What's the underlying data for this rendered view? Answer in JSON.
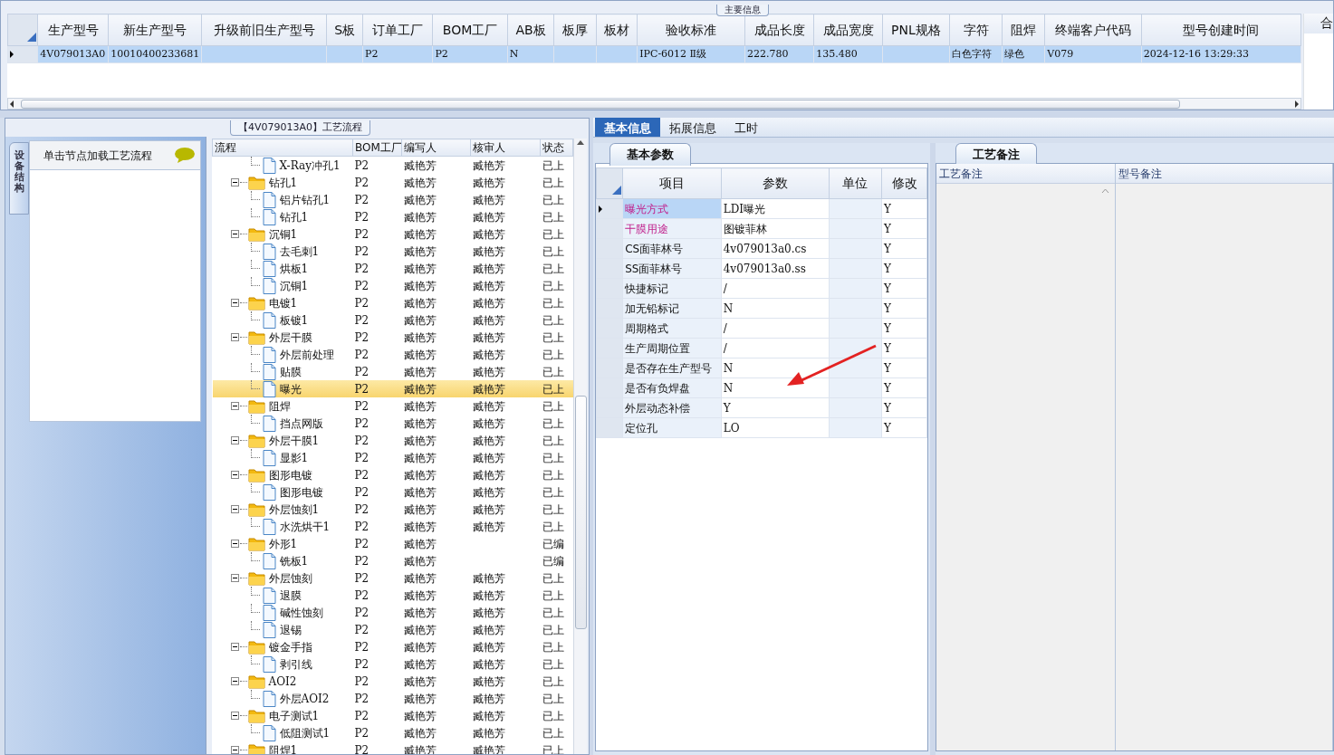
{
  "main_info": {
    "caption": "主要信息",
    "columns": [
      "生产型号",
      "新生产型号",
      "升级前旧生产型号",
      "S板",
      "订单工厂",
      "BOM工厂",
      "AB板",
      "板厚",
      "板材",
      "验收标准",
      "成品长度",
      "成品宽度",
      "PNL规格",
      "字符",
      "阻焊",
      "终端客户代码",
      "型号创建时间"
    ],
    "rows": [
      {
        "selected": true,
        "cells": [
          "4V079013A0",
          "10010400233681",
          null,
          null,
          "P2",
          "P2",
          "N",
          null,
          null,
          "IPC-6012 Ⅱ级",
          "222.780",
          "135.480",
          null,
          "白色字符",
          "绿色",
          "V079",
          "2024-12-16 13:29:33"
        ]
      }
    ],
    "side_column": "合"
  },
  "process": {
    "caption": "【4V079013A0】工艺流程",
    "side_tab": "设备结构",
    "hint": "单击节点加载工艺流程",
    "columns": [
      "流程",
      "BOM工厂",
      "编写人",
      "核审人",
      "状态"
    ],
    "tree": [
      {
        "kind": "file",
        "name": "X-Ray冲孔1",
        "bom": "P2",
        "author": "臧艳芳",
        "reviewer": "臧艳芳",
        "status": "已上",
        "selected": false
      },
      {
        "kind": "folder",
        "name": "钻孔1",
        "bom": "P2",
        "author": "臧艳芳",
        "reviewer": "臧艳芳",
        "status": "已上",
        "selected": false,
        "expanded": true,
        "children": [
          {
            "kind": "file",
            "name": "铝片钻孔1",
            "bom": "P2",
            "author": "臧艳芳",
            "reviewer": "臧艳芳",
            "status": "已上",
            "selected": false
          },
          {
            "kind": "file",
            "name": "钻孔1",
            "bom": "P2",
            "author": "臧艳芳",
            "reviewer": "臧艳芳",
            "status": "已上",
            "selected": false
          }
        ]
      },
      {
        "kind": "folder",
        "name": "沉铜1",
        "bom": "P2",
        "author": "臧艳芳",
        "reviewer": "臧艳芳",
        "status": "已上",
        "selected": false,
        "expanded": true,
        "children": [
          {
            "kind": "file",
            "name": "去毛刺1",
            "bom": "P2",
            "author": "臧艳芳",
            "reviewer": "臧艳芳",
            "status": "已上",
            "selected": false
          },
          {
            "kind": "file",
            "name": "烘板1",
            "bom": "P2",
            "author": "臧艳芳",
            "reviewer": "臧艳芳",
            "status": "已上",
            "selected": false
          },
          {
            "kind": "file",
            "name": "沉铜1",
            "bom": "P2",
            "author": "臧艳芳",
            "reviewer": "臧艳芳",
            "status": "已上",
            "selected": false
          }
        ]
      },
      {
        "kind": "folder",
        "name": "电镀1",
        "bom": "P2",
        "author": "臧艳芳",
        "reviewer": "臧艳芳",
        "status": "已上",
        "selected": false,
        "expanded": true,
        "children": [
          {
            "kind": "file",
            "name": "板镀1",
            "bom": "P2",
            "author": "臧艳芳",
            "reviewer": "臧艳芳",
            "status": "已上",
            "selected": false
          }
        ]
      },
      {
        "kind": "folder",
        "name": "外层干膜",
        "bom": "P2",
        "author": "臧艳芳",
        "reviewer": "臧艳芳",
        "status": "已上",
        "selected": false,
        "expanded": true,
        "children": [
          {
            "kind": "file",
            "name": "外层前处理",
            "bom": "P2",
            "author": "臧艳芳",
            "reviewer": "臧艳芳",
            "status": "已上",
            "selected": false
          },
          {
            "kind": "file",
            "name": "贴膜",
            "bom": "P2",
            "author": "臧艳芳",
            "reviewer": "臧艳芳",
            "status": "已上",
            "selected": false
          },
          {
            "kind": "file",
            "name": "曝光",
            "bom": "P2",
            "author": "臧艳芳",
            "reviewer": "臧艳芳",
            "status": "已上",
            "selected": true
          }
        ]
      },
      {
        "kind": "folder",
        "name": "阻焊",
        "bom": "P2",
        "author": "臧艳芳",
        "reviewer": "臧艳芳",
        "status": "已上",
        "selected": false,
        "expanded": true,
        "children": [
          {
            "kind": "file",
            "name": "挡点网版",
            "bom": "P2",
            "author": "臧艳芳",
            "reviewer": "臧艳芳",
            "status": "已上",
            "selected": false
          }
        ]
      },
      {
        "kind": "folder",
        "name": "外层干膜1",
        "bom": "P2",
        "author": "臧艳芳",
        "reviewer": "臧艳芳",
        "status": "已上",
        "selected": false,
        "expanded": true,
        "children": [
          {
            "kind": "file",
            "name": "显影1",
            "bom": "P2",
            "author": "臧艳芳",
            "reviewer": "臧艳芳",
            "status": "已上",
            "selected": false
          }
        ]
      },
      {
        "kind": "folder",
        "name": "图形电镀",
        "bom": "P2",
        "author": "臧艳芳",
        "reviewer": "臧艳芳",
        "status": "已上",
        "selected": false,
        "expanded": true,
        "children": [
          {
            "kind": "file",
            "name": "图形电镀",
            "bom": "P2",
            "author": "臧艳芳",
            "reviewer": "臧艳芳",
            "status": "已上",
            "selected": false
          }
        ]
      },
      {
        "kind": "folder",
        "name": "外层蚀刻1",
        "bom": "P2",
        "author": "臧艳芳",
        "reviewer": "臧艳芳",
        "status": "已上",
        "selected": false,
        "expanded": true,
        "children": [
          {
            "kind": "file",
            "name": "水洗烘干1",
            "bom": "P2",
            "author": "臧艳芳",
            "reviewer": "臧艳芳",
            "status": "已上",
            "selected": false
          }
        ]
      },
      {
        "kind": "folder",
        "name": "外形1",
        "bom": "P2",
        "author": "臧艳芳",
        "status": "已编",
        "selected": false,
        "expanded": true,
        "children": [
          {
            "kind": "file",
            "name": "铣板1",
            "bom": "P2",
            "author": "臧艳芳",
            "status": "已编",
            "selected": false
          }
        ]
      },
      {
        "kind": "folder",
        "name": "外层蚀刻",
        "bom": "P2",
        "author": "臧艳芳",
        "reviewer": "臧艳芳",
        "status": "已上",
        "selected": false,
        "expanded": true,
        "children": [
          {
            "kind": "file",
            "name": "退膜",
            "bom": "P2",
            "author": "臧艳芳",
            "reviewer": "臧艳芳",
            "status": "已上",
            "selected": false
          },
          {
            "kind": "file",
            "name": "碱性蚀刻",
            "bom": "P2",
            "author": "臧艳芳",
            "reviewer": "臧艳芳",
            "status": "已上",
            "selected": false
          },
          {
            "kind": "file",
            "name": "退锡",
            "bom": "P2",
            "author": "臧艳芳",
            "reviewer": "臧艳芳",
            "status": "已上",
            "selected": false
          }
        ]
      },
      {
        "kind": "folder",
        "name": "镀金手指",
        "bom": "P2",
        "author": "臧艳芳",
        "reviewer": "臧艳芳",
        "status": "已上",
        "selected": false,
        "expanded": true,
        "children": [
          {
            "kind": "file",
            "name": "剥引线",
            "bom": "P2",
            "author": "臧艳芳",
            "reviewer": "臧艳芳",
            "status": "已上",
            "selected": false
          }
        ]
      },
      {
        "kind": "folder",
        "name": "AOI2",
        "bom": "P2",
        "author": "臧艳芳",
        "reviewer": "臧艳芳",
        "status": "已上",
        "selected": false,
        "expanded": true,
        "children": [
          {
            "kind": "file",
            "name": "外层AOI2",
            "bom": "P2",
            "author": "臧艳芳",
            "reviewer": "臧艳芳",
            "status": "已上",
            "selected": false
          }
        ]
      },
      {
        "kind": "folder",
        "name": "电子测试1",
        "bom": "P2",
        "author": "臧艳芳",
        "reviewer": "臧艳芳",
        "status": "已上",
        "selected": false,
        "expanded": true,
        "children": [
          {
            "kind": "file",
            "name": "低阻测试1",
            "bom": "P2",
            "author": "臧艳芳",
            "reviewer": "臧艳芳",
            "status": "已上",
            "selected": false
          }
        ]
      },
      {
        "kind": "folder",
        "name": "阻焊1",
        "bom": "P2",
        "author": "臧艳芳",
        "reviewer": "臧艳芳",
        "status": "已上",
        "selected": false,
        "expanded": true
      }
    ]
  },
  "detail": {
    "tabs": [
      {
        "label": "基本信息",
        "selected": true
      },
      {
        "label": "拓展信息",
        "selected": false
      },
      {
        "label": "工时",
        "selected": false
      }
    ],
    "params": {
      "tab": "基本参数",
      "columns": [
        "项目",
        "参数",
        "单位",
        "修改"
      ],
      "rows": [
        {
          "item": "曝光方式",
          "value": "LDI曝光",
          "modified": "Y",
          "emphasized": true,
          "selected": true
        },
        {
          "item": "干膜用途",
          "value": "图镀菲林",
          "modified": "Y",
          "emphasized": true,
          "selected": false
        },
        {
          "item": "CS面菲林号",
          "value": "4v079013a0.cs",
          "modified": "Y",
          "emphasized": false,
          "selected": false
        },
        {
          "item": "SS面菲林号",
          "value": "4v079013a0.ss",
          "modified": "Y",
          "emphasized": false,
          "selected": false
        },
        {
          "item": "快捷标记",
          "value": "/",
          "modified": "Y",
          "emphasized": false,
          "selected": false
        },
        {
          "item": "加无铅标记",
          "value": "N",
          "modified": "Y",
          "emphasized": false,
          "selected": false
        },
        {
          "item": "周期格式",
          "value": "/",
          "modified": "Y",
          "emphasized": false,
          "selected": false
        },
        {
          "item": "生产周期位置",
          "value": "/",
          "modified": "Y",
          "emphasized": false,
          "selected": false
        },
        {
          "item": "是否存在生产型号",
          "value": "N",
          "modified": "Y",
          "emphasized": false,
          "selected": false
        },
        {
          "item": "是否有负焊盘",
          "value": "N",
          "modified": "Y",
          "emphasized": false,
          "selected": false
        },
        {
          "item": "外层动态补偿",
          "value": "Y",
          "modified": "Y",
          "emphasized": false,
          "selected": false
        },
        {
          "item": "定位孔",
          "value": "LO",
          "modified": "Y",
          "emphasized": false,
          "selected": false
        }
      ]
    },
    "remarks": {
      "tab": "工艺备注",
      "columns": [
        "工艺备注",
        "型号备注"
      ]
    }
  }
}
